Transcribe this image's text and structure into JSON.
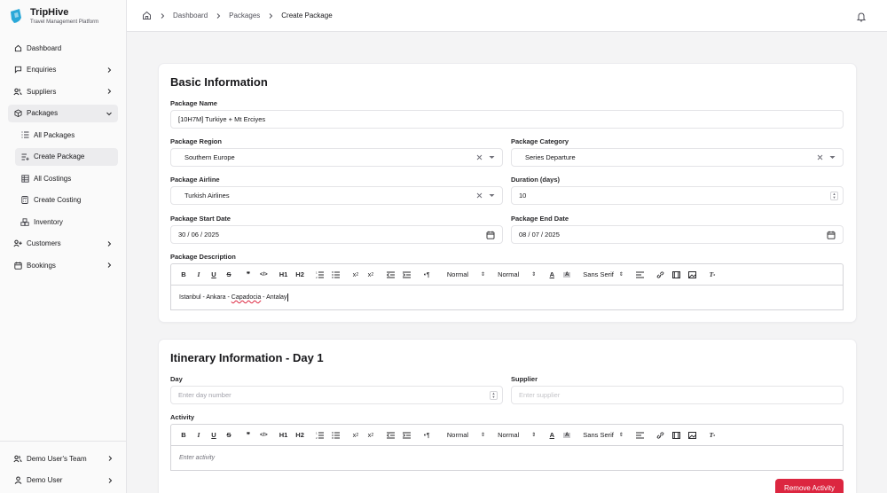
{
  "brand": {
    "name": "TripHive",
    "subtitle": "Travel Management Platform"
  },
  "sidebar": {
    "items": [
      {
        "label": "Dashboard",
        "icon": "home-icon"
      },
      {
        "label": "Enquiries",
        "icon": "message-square-icon"
      },
      {
        "label": "Suppliers",
        "icon": "users-icon"
      },
      {
        "label": "Packages",
        "icon": "package-icon"
      }
    ],
    "sub_items": [
      {
        "label": "All Packages",
        "icon": "list-icon"
      },
      {
        "label": "Create Package",
        "icon": "list-plus-icon"
      },
      {
        "label": "All Costings",
        "icon": "table-icon"
      },
      {
        "label": "Create Costing",
        "icon": "calculator-icon"
      },
      {
        "label": "Inventory",
        "icon": "boxes-icon"
      }
    ],
    "items_after": [
      {
        "label": "Customers",
        "icon": "user-plus-icon"
      },
      {
        "label": "Bookings",
        "icon": "calendar-icon"
      }
    ],
    "team": "Demo User's Team",
    "user": "Demo User"
  },
  "header": {
    "breadcrumbs": [
      "Dashboard",
      "Packages",
      "Create Package"
    ]
  },
  "basic": {
    "title": "Basic Information",
    "package_name_label": "Package Name",
    "package_name_value": "[10H7M] Turkiye + Mt Erciyes",
    "region_label": "Package Region",
    "region_value": "Southern Europe",
    "category_label": "Package Category",
    "category_value": "Series Departure",
    "airline_label": "Package Airline",
    "airline_value": "Turkish Airlines",
    "duration_label": "Duration (days)",
    "duration_value": "10",
    "start_label": "Package Start Date",
    "start_value": "30 / 06 / 2025",
    "end_label": "Package End Date",
    "end_value": "08 / 07 / 2025",
    "description_label": "Package Description",
    "description_value_pre": "Istanbul - Ankara - ",
    "description_value_mis": "Capadocia",
    "description_value_post": " - Antalay"
  },
  "toolbar": {
    "header1": "H1",
    "header2": "H2",
    "size": "Normal",
    "heading": "Normal",
    "font": "Sans Serif"
  },
  "itinerary": {
    "title": "Itinerary Information - Day 1",
    "day_label": "Day",
    "day_placeholder": "Enter day number",
    "supplier_label": "Supplier",
    "supplier_placeholder": "Enter supplier",
    "activity_label": "Activity",
    "activity_placeholder": "Enter activity",
    "remove_button": "Remove Activity"
  },
  "colors": {
    "accent": "#dc2640",
    "brand": "#2aa8d8"
  }
}
